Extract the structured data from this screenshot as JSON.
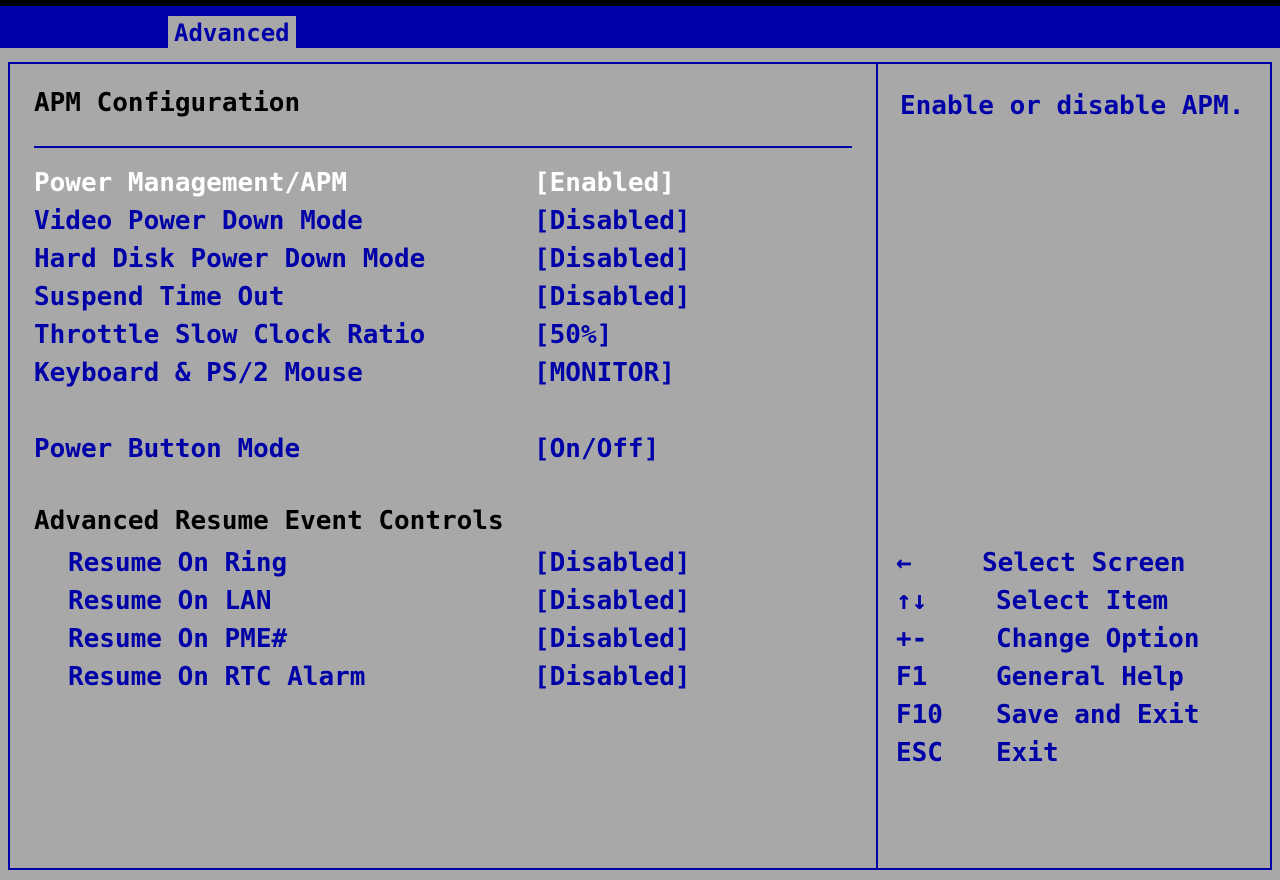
{
  "menu": {
    "active_tab": "Advanced"
  },
  "page": {
    "title": "APM Configuration"
  },
  "settings": [
    {
      "label": "Power Management/APM",
      "value": "[Enabled]"
    },
    {
      "label": "Video Power Down Mode",
      "value": "[Disabled]"
    },
    {
      "label": "Hard Disk Power Down Mode",
      "value": "[Disabled]"
    },
    {
      "label": "Suspend Time Out",
      "value": "[Disabled]"
    },
    {
      "label": "Throttle Slow Clock Ratio",
      "value": "[50%]"
    },
    {
      "label": "Keyboard & PS/2 Mouse",
      "value": "[MONITOR]"
    },
    {
      "label": "Power Button Mode",
      "value": "[On/Off]"
    }
  ],
  "resume_group": {
    "title": "Advanced Resume Event Controls",
    "items": [
      {
        "label": "Resume On Ring",
        "value": "[Disabled]"
      },
      {
        "label": "Resume On LAN",
        "value": "[Disabled]"
      },
      {
        "label": "Resume On PME#",
        "value": "[Disabled]"
      },
      {
        "label": "Resume On RTC Alarm",
        "value": "[Disabled]"
      }
    ]
  },
  "help": {
    "text": "Enable or disable APM."
  },
  "keys": [
    {
      "key": "←",
      "desc": "Select Screen",
      "icon": "arrow-left-icon"
    },
    {
      "key": "↑↓",
      "desc": "Select Item",
      "icon": "arrow-up-down-icon"
    },
    {
      "key": "+-",
      "desc": "Change Option",
      "icon": "plus-minus-icon"
    },
    {
      "key": "F1",
      "desc": "General Help"
    },
    {
      "key": "F10",
      "desc": "Save and Exit"
    },
    {
      "key": "ESC",
      "desc": "Exit"
    }
  ],
  "colors": {
    "background": "#a8a8a8",
    "accent_blue": "#0000a8",
    "selected_text": "#ffffff"
  }
}
